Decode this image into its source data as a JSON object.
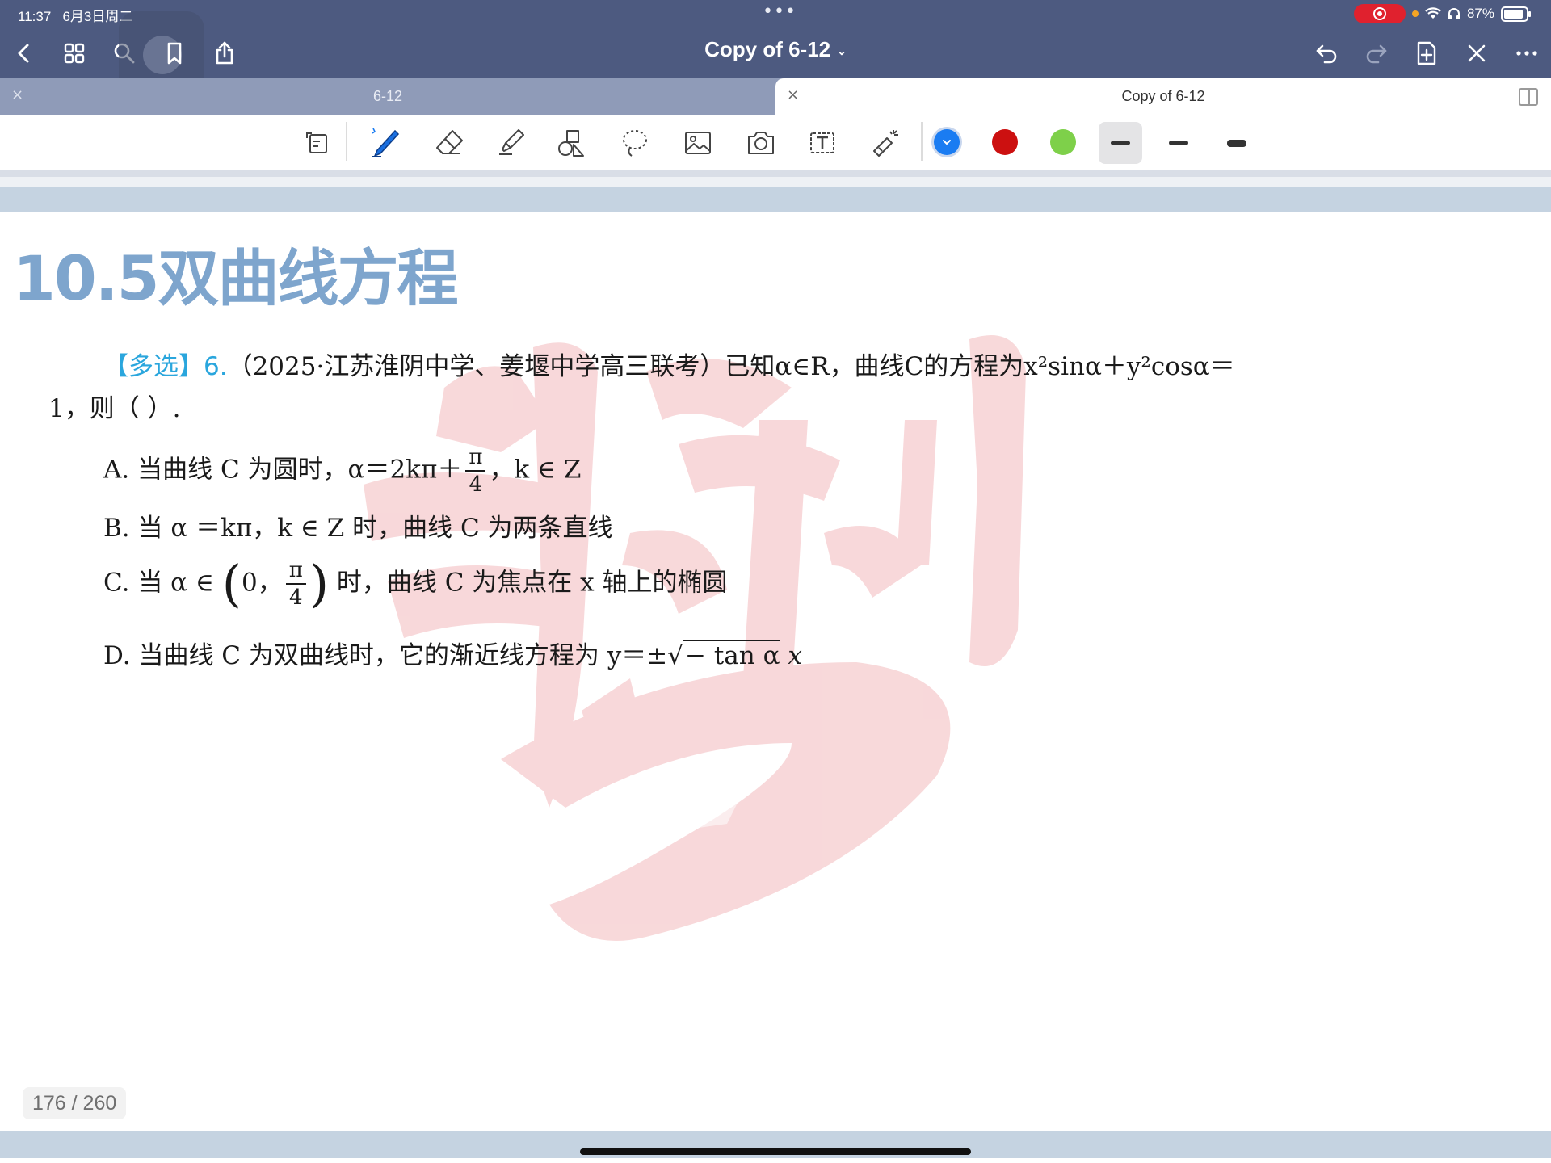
{
  "status_bar": {
    "time": "11:37",
    "date": "6月3日周二",
    "battery": "87%",
    "center_dots": "•••"
  },
  "nav": {
    "title": "Copy of 6-12",
    "title_chevron": "⌄",
    "left_icons": [
      "back-icon",
      "grid-icon",
      "search-icon",
      "bookmark-icon",
      "share-icon"
    ],
    "right_icons": [
      "undo-icon",
      "redo-icon",
      "add-page-icon",
      "close-tab-icon",
      "more-icon"
    ]
  },
  "tabs": [
    {
      "label": "6-12",
      "active": false,
      "close": "×"
    },
    {
      "label": "Copy of 6-12",
      "active": true,
      "close": "×"
    }
  ],
  "toolbar": {
    "tools": [
      "shape-recognition-icon",
      "pen-icon",
      "eraser-icon",
      "highlighter-icon",
      "shapes-icon",
      "lasso-icon",
      "image-icon",
      "camera-icon",
      "textbox-icon",
      "laser-pointer-icon"
    ],
    "colors": [
      "#1a7cf2",
      "#cc1010",
      "#7ed04a"
    ],
    "selected_color": "#1a7cf2",
    "thickness_selected": 0
  },
  "page": {
    "section_title": "10.5双曲线方程",
    "question": {
      "tag": "【多选】6.",
      "line1": "（2025·江苏淮阴中学、姜堰中学高三联考）已知α∈R，曲线C的方程为x²sinα＋y²cosα＝",
      "line2": "1，则（          ）.",
      "option_a_prefix": "A. 当曲线 C 为圆时，α＝2kπ＋",
      "option_a_frac_num": "π",
      "option_a_frac_den": "4",
      "option_a_suffix": "，k ∈ Z",
      "option_b": "B. 当 α ＝kπ，k ∈ Z 时，曲线 C 为两条直线",
      "option_c_prefix": "C. 当 α ∈",
      "option_c_interval_left": "0，",
      "option_c_frac_num": "π",
      "option_c_frac_den": "4",
      "option_c_suffix": "时，曲线 C 为焦点在 x 轴上的椭圆",
      "option_d_prefix": "D. 当曲线 C 为双曲线时，它的渐近线方程为 y＝±",
      "option_d_sqrt": "− tan α",
      "option_d_suffix": "x"
    },
    "page_indicator": "176 / 260"
  }
}
